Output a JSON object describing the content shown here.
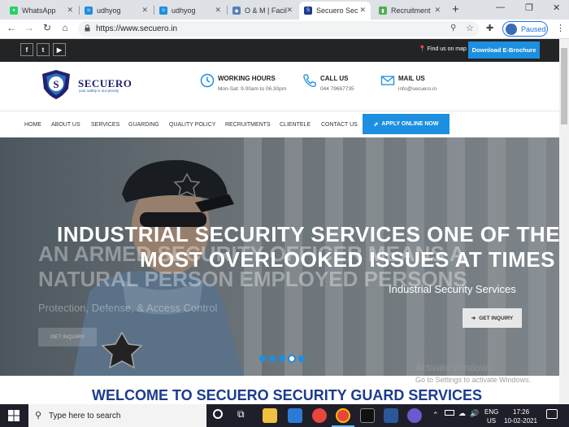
{
  "browser": {
    "tabs": [
      {
        "label": "WhatsApp",
        "color": "#25d366"
      },
      {
        "label": "udhyog",
        "color": "#1d8fe0"
      },
      {
        "label": "udhyog",
        "color": "#1d8fe0"
      },
      {
        "label": "O & M | Facil",
        "color": "#5b7fb8"
      },
      {
        "label": "Secuero Sec",
        "color": "#1c3b8f"
      },
      {
        "label": "Recruitment",
        "color": "#4caf50"
      }
    ],
    "new_tab": "+",
    "url": "https://www.secuero.in",
    "profile_status": "Paused"
  },
  "site": {
    "social": [
      "f",
      "t",
      "▶"
    ],
    "find_map": "Find us on map",
    "brochure": "Download E-Brochure",
    "logo": {
      "name": "SECUERO",
      "tagline": "your safety is our priority"
    },
    "contact": [
      {
        "title": "WORKING HOURS",
        "value": "Mon-Sat: 9.00am to 06.30pm"
      },
      {
        "title": "CALL US",
        "value": "044 79667735"
      },
      {
        "title": "MAIL US",
        "value": "info@secuero.in"
      }
    ],
    "menu": [
      "HOME",
      "ABOUT US",
      "SERVICES",
      "GUARDING",
      "QUALITY POLICY",
      "RECRUITMENTS",
      "CLIENTELE",
      "CONTACT US"
    ],
    "apply_button": "APPLY ONLINE NOW",
    "hero": {
      "headline_line1": "INDUSTRIAL SECURITY SERVICES ONE OF THE",
      "headline_line2": "MOST OVERLOOKED ISSUES AT TIMES",
      "subheading": "Industrial Security Services",
      "cta": "GET INQUIRY",
      "prev_headline_line1": "AN ARMED SECURITY OFFICER MEANS A",
      "prev_headline_line2": "NATURAL PERSON EMPLOYED PERSONS",
      "prev_subheading": "Protection, Defense, & Access Control",
      "prev_cta": "GET INQUIRY",
      "slides": 5,
      "active_slide": 4
    },
    "welcome": "WELCOME TO SECUERO SECURITY GUARD SERVICES"
  },
  "watermark": {
    "line1": "Activate Windows",
    "line2": "Go to Settings to activate Windows."
  },
  "taskbar": {
    "search_placeholder": "Type here to search",
    "language": "ENG",
    "region": "US",
    "time": "17:26",
    "date": "10-02-2021"
  }
}
